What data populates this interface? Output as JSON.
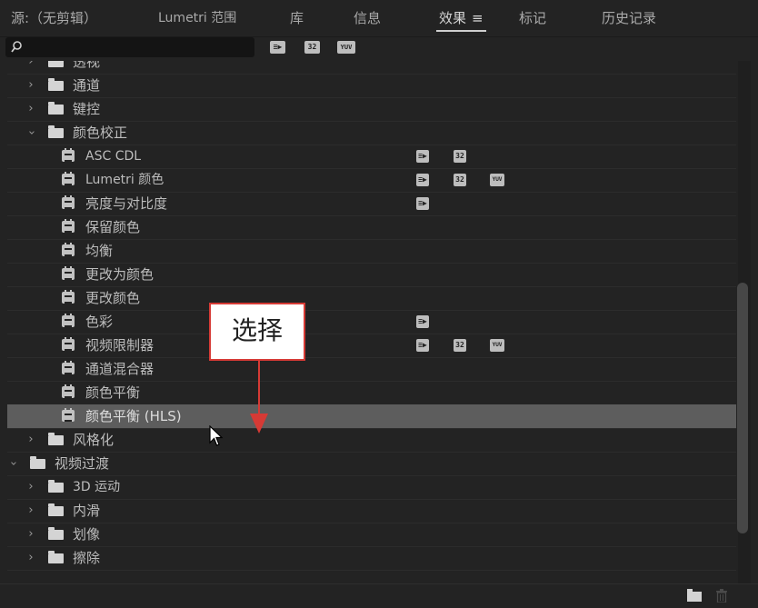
{
  "tabs": [
    {
      "label": "源:（无剪辑）",
      "active": false
    },
    {
      "label": "Lumetri 范围",
      "active": false
    },
    {
      "label": "库",
      "active": false
    },
    {
      "label": "信息",
      "active": false
    },
    {
      "label": "效果",
      "active": true
    },
    {
      "label": "标记",
      "active": false
    },
    {
      "label": "历史记录",
      "active": false
    }
  ],
  "menu_icon": "≡",
  "search": {
    "placeholder": "",
    "icon": "search-icon"
  },
  "toolbar_badges": [
    "accelerated-effects",
    "32-bit",
    "YUV"
  ],
  "badge_text": {
    "fx": "≡▶",
    "b32": "32",
    "yuv": "YUV"
  },
  "tree": [
    {
      "label": "透视",
      "type": "folder",
      "expanded": false
    },
    {
      "label": "通道",
      "type": "folder",
      "expanded": false
    },
    {
      "label": "键控",
      "type": "folder",
      "expanded": false
    },
    {
      "label": "颜色校正",
      "type": "folder",
      "expanded": true
    },
    {
      "label": "ASC CDL",
      "type": "effect",
      "badges": [
        "fx",
        "32"
      ]
    },
    {
      "label": "Lumetri 颜色",
      "type": "effect",
      "badges": [
        "fx",
        "32",
        "yuv"
      ]
    },
    {
      "label": "亮度与对比度",
      "type": "effect",
      "badges": [
        "fx"
      ]
    },
    {
      "label": "保留颜色",
      "type": "effect",
      "badges": []
    },
    {
      "label": "均衡",
      "type": "effect",
      "badges": []
    },
    {
      "label": "更改为颜色",
      "type": "effect",
      "badges": []
    },
    {
      "label": "更改颜色",
      "type": "effect",
      "badges": []
    },
    {
      "label": "色彩",
      "type": "effect",
      "badges": [
        "fx"
      ]
    },
    {
      "label": "视频限制器",
      "type": "effect",
      "badges": [
        "fx",
        "32",
        "yuv"
      ]
    },
    {
      "label": "通道混合器",
      "type": "effect",
      "badges": []
    },
    {
      "label": "颜色平衡",
      "type": "effect",
      "badges": []
    },
    {
      "label": "颜色平衡 (HLS)",
      "type": "effect",
      "badges": [],
      "selected": true
    },
    {
      "label": "风格化",
      "type": "folder",
      "expanded": false
    },
    {
      "label": "视频过渡",
      "type": "folder",
      "expanded": true,
      "level": 0
    },
    {
      "label": "3D 运动",
      "type": "folder",
      "expanded": false
    },
    {
      "label": "内滑",
      "type": "folder",
      "expanded": false
    },
    {
      "label": "划像",
      "type": "folder",
      "expanded": false
    },
    {
      "label": "擦除",
      "type": "folder",
      "expanded": false
    }
  ],
  "annotation": {
    "label": "选择",
    "color": "#d63a35"
  },
  "colors": {
    "background": "#232323",
    "selected_row": "#5d5d5d",
    "accent": "#d63a35"
  }
}
